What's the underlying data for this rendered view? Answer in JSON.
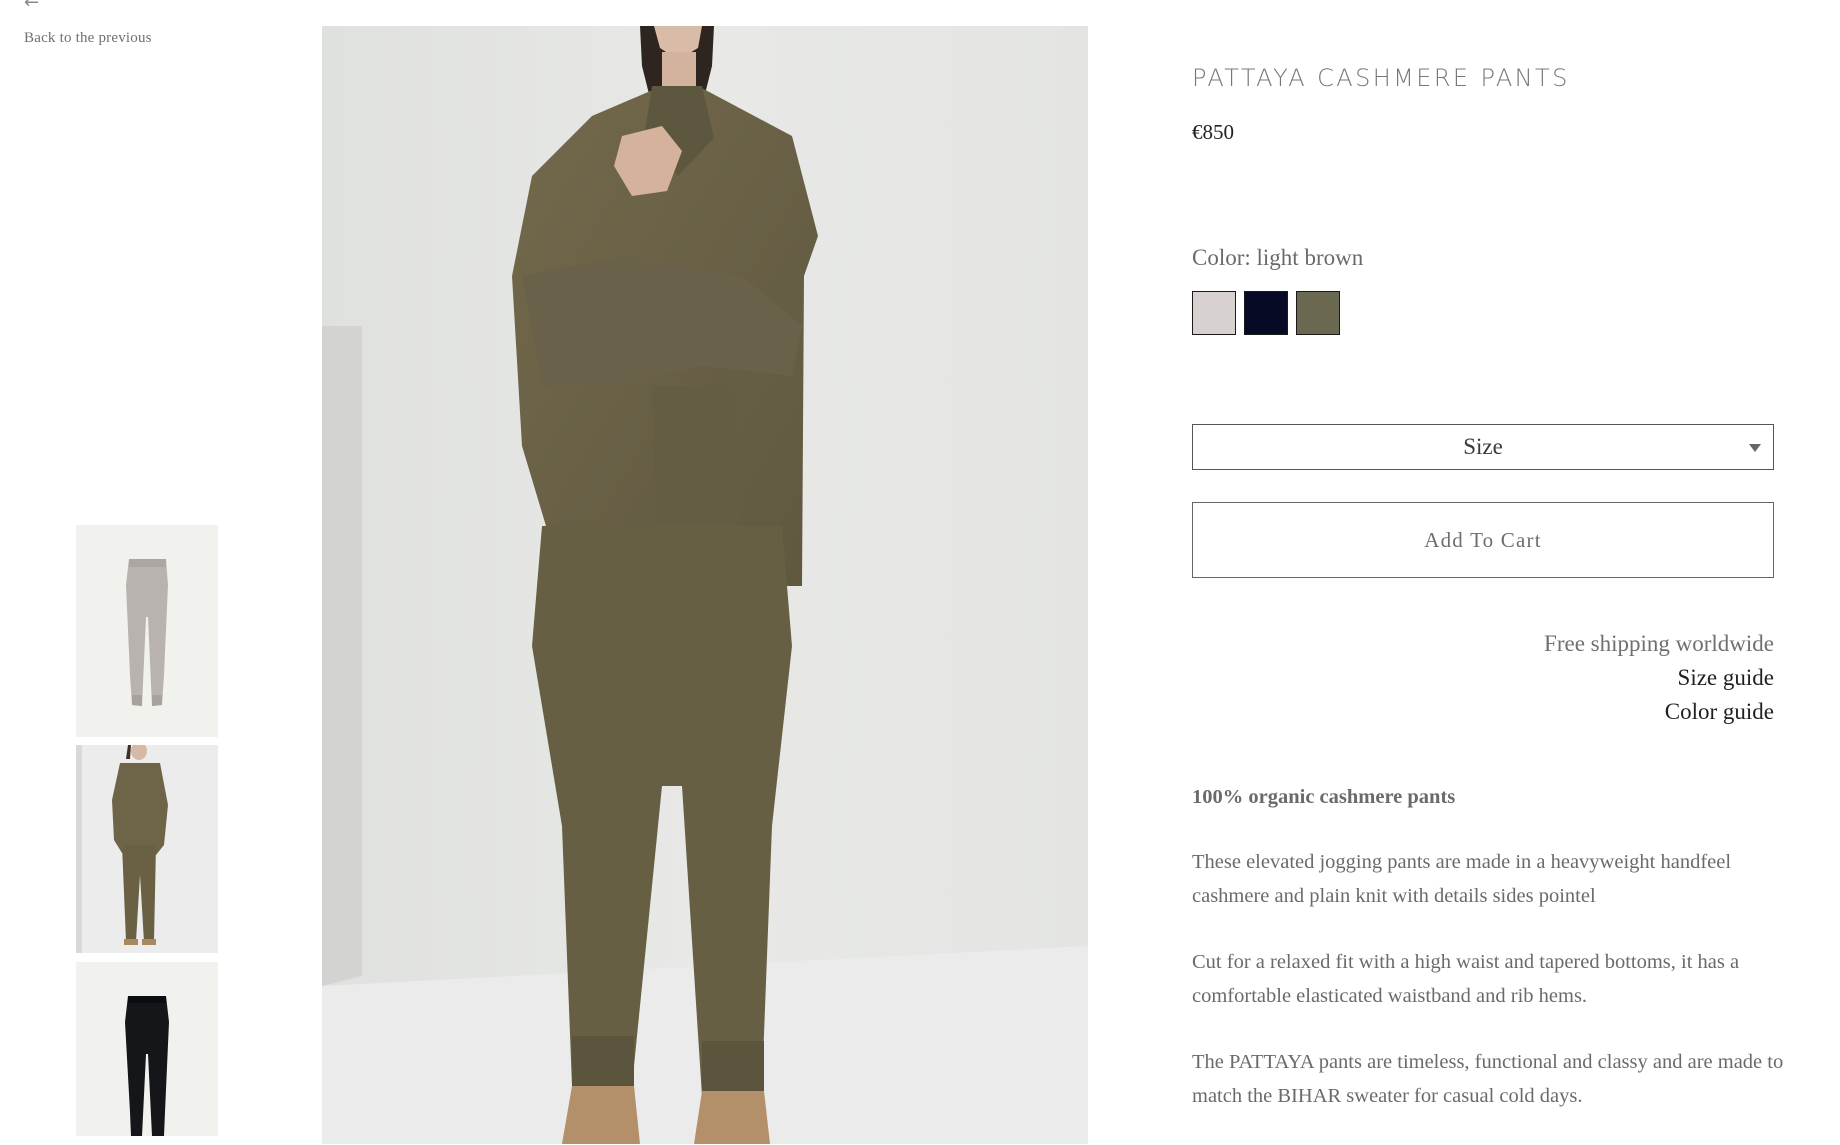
{
  "nav": {
    "back_arrow": "←",
    "back_label": "Back to the previous"
  },
  "gallery": {
    "thumbnails": [
      {
        "icon": "pants-light-grey-thumbnail",
        "color": "#b8b2ae"
      },
      {
        "icon": "model-light-brown-thumbnail",
        "color": "#6e6447"
      },
      {
        "icon": "pants-black-thumbnail",
        "color": "#15161a"
      }
    ],
    "main_image": "model-wearing-light-brown-cashmere-set"
  },
  "product": {
    "title": "PATTAYA CASHMERE PANTS",
    "price": "€850",
    "color_label": "Color: light brown",
    "swatches": [
      {
        "name": "light-grey",
        "color": "#d7d1d0"
      },
      {
        "name": "navy",
        "color": "#070a24"
      },
      {
        "name": "light-brown",
        "color": "#6a6850"
      }
    ],
    "size_label": "Size",
    "add_to_cart_label": "Add To Cart",
    "shipping_text": "Free shipping worldwide",
    "size_guide_label": "Size guide",
    "color_guide_label": "Color guide",
    "description_headline": "100% organic cashmere pants",
    "description_paragraphs": [
      "These elevated jogging pants are made in a heavyweight handfeel cashmere and plain knit with details sides pointel",
      "Cut for a relaxed fit with a high waist and tapered bottoms, it has a comfortable elasticated waistband and rib hems.",
      "The PATTAYA pants are timeless, functional and classy and are made to match the BIHAR sweater for casual cold days."
    ]
  }
}
